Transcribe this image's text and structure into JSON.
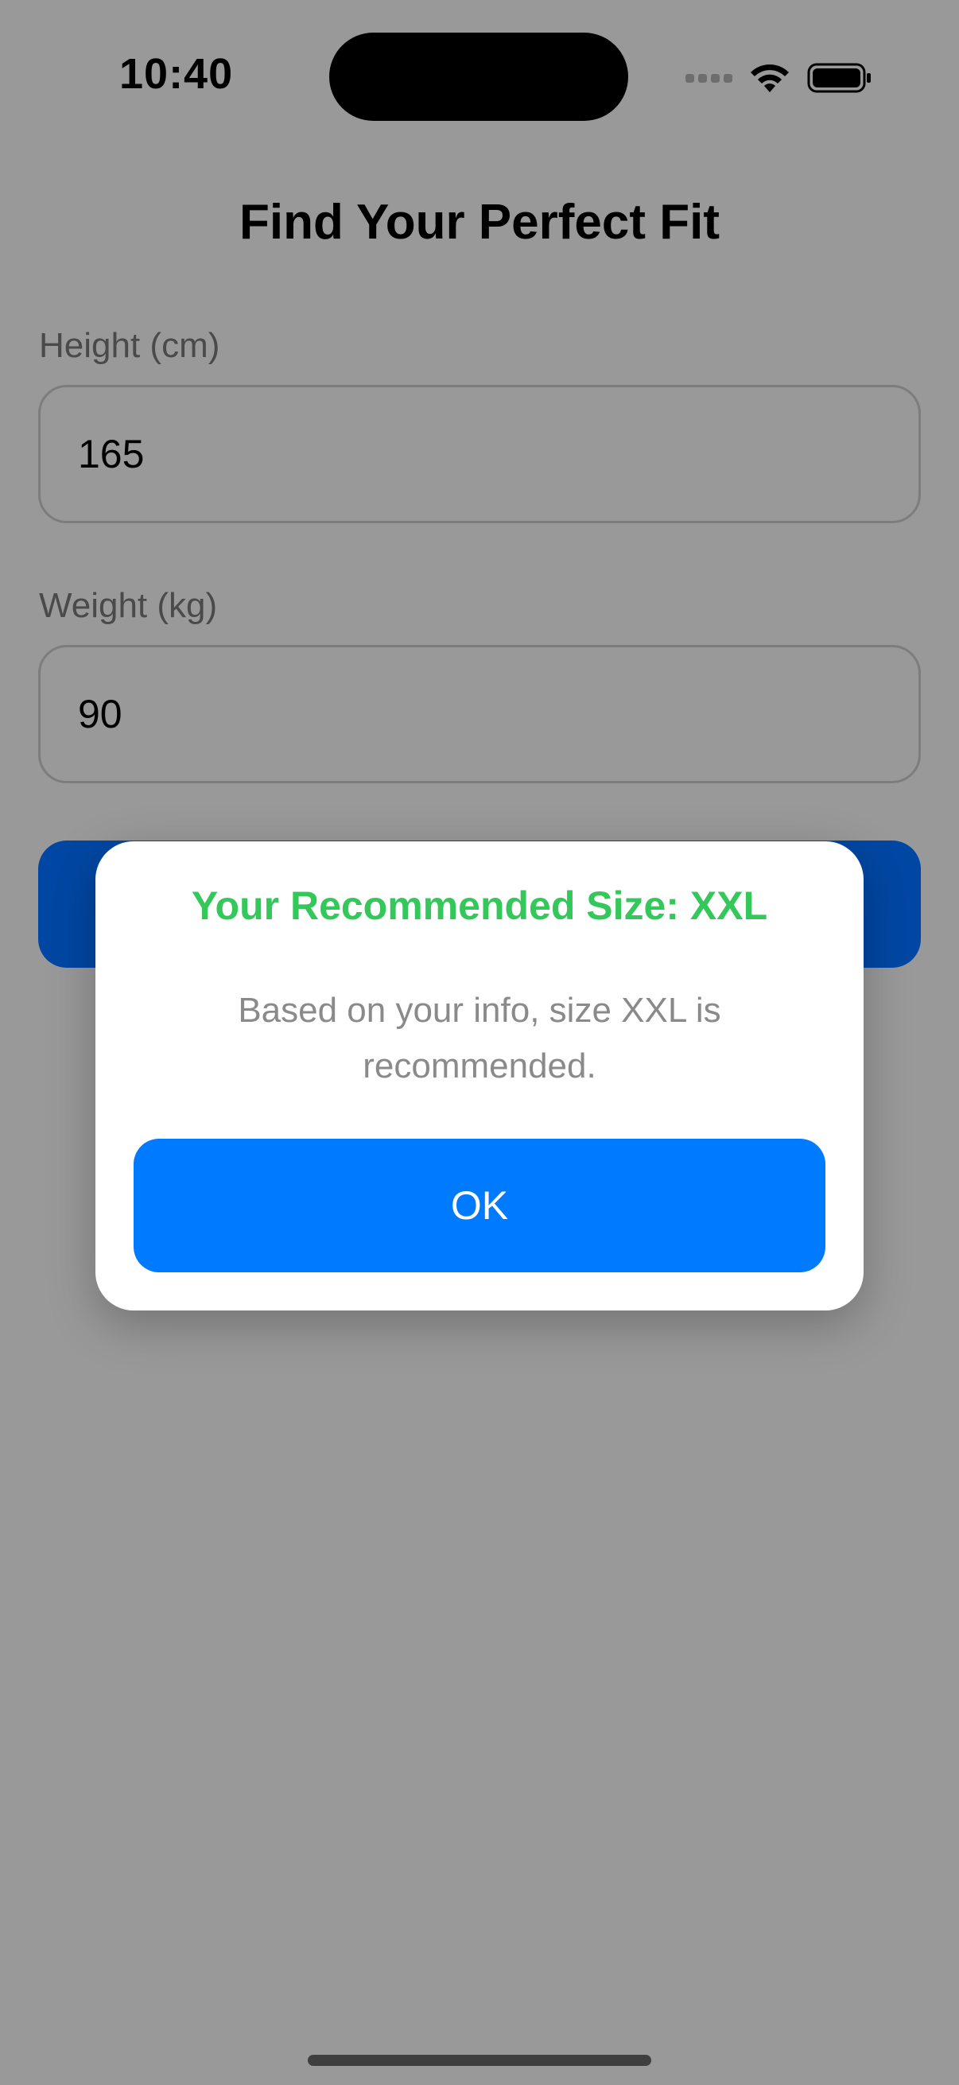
{
  "status_bar": {
    "time": "10:40"
  },
  "page": {
    "title": "Find Your Perfect Fit"
  },
  "form": {
    "height": {
      "label": "Height (cm)",
      "value": "165"
    },
    "weight": {
      "label": "Weight (kg)",
      "value": "90"
    }
  },
  "dialog": {
    "title": "Your Recommended Size: XXL",
    "message": "Based on your info, size XXL is recommended.",
    "ok_label": "OK"
  },
  "colors": {
    "accent": "#007aff",
    "success": "#34c759",
    "overlay": "#999999"
  },
  "icons": [
    "cellular-signal-icon",
    "wifi-icon",
    "battery-icon"
  ]
}
